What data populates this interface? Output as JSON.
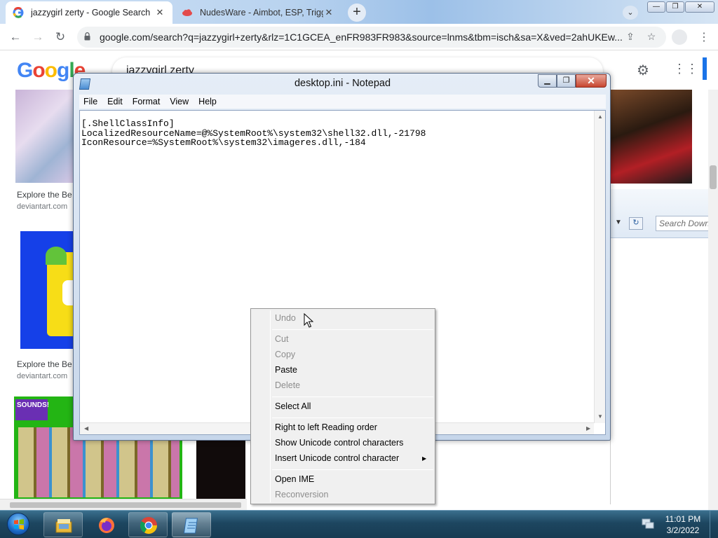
{
  "browser": {
    "tabs": [
      {
        "title": "jazzygirl zerty - Google Search",
        "active": true
      },
      {
        "title": "NudesWare - Aimbot, ESP, Trigge",
        "active": false
      }
    ],
    "new_tab_label": "+",
    "url": "google.com/search?q=jazzygirl+zerty&rlz=1C1GCEA_enFR983FR983&source=lnms&tbm=isch&sa=X&ved=2ahUKEw...",
    "window_buttons": {
      "minimize": "—",
      "restore": "❐",
      "close": "✕"
    }
  },
  "google": {
    "logo": "Google",
    "query": "jazzygirl zerty",
    "results": [
      {
        "caption": "Explore the Be",
        "source": "deviantart.com"
      },
      {
        "caption": "Explore the Be",
        "source": "deviantart.com"
      }
    ],
    "sounds_badge": "SOUNDS!"
  },
  "explorer": {
    "search_placeholder": "Search Downloads"
  },
  "notepad": {
    "title": "desktop.ini - Notepad",
    "menus": [
      "File",
      "Edit",
      "Format",
      "View",
      "Help"
    ],
    "content": "[.ShellClassInfo]\nLocalizedResourceName=@%SystemRoot%\\system32\\shell32.dll,-21798\nIconResource=%SystemRoot%\\system32\\imageres.dll,-184"
  },
  "context_menu": {
    "items": [
      {
        "label": "Undo",
        "enabled": false
      },
      {
        "label": "Cut",
        "enabled": false
      },
      {
        "label": "Copy",
        "enabled": false
      },
      {
        "label": "Paste",
        "enabled": true
      },
      {
        "label": "Delete",
        "enabled": false
      },
      {
        "label": "Select All",
        "enabled": true
      },
      {
        "label": "Right to left Reading order",
        "enabled": true
      },
      {
        "label": "Show Unicode control characters",
        "enabled": true
      },
      {
        "label": "Insert Unicode control character",
        "enabled": true,
        "submenu": true
      },
      {
        "label": "Open IME",
        "enabled": true
      },
      {
        "label": "Reconversion",
        "enabled": false
      }
    ]
  },
  "taskbar": {
    "apps": [
      "file-explorer",
      "firefox",
      "chrome",
      "notepad"
    ],
    "time": "11:01 PM",
    "date": "3/2/2022"
  },
  "colors": {
    "google_blue": "#4285f4",
    "google_red": "#ea4335",
    "google_yellow": "#fbbc05",
    "google_green": "#34a853",
    "taskbar": "#1d4660"
  }
}
